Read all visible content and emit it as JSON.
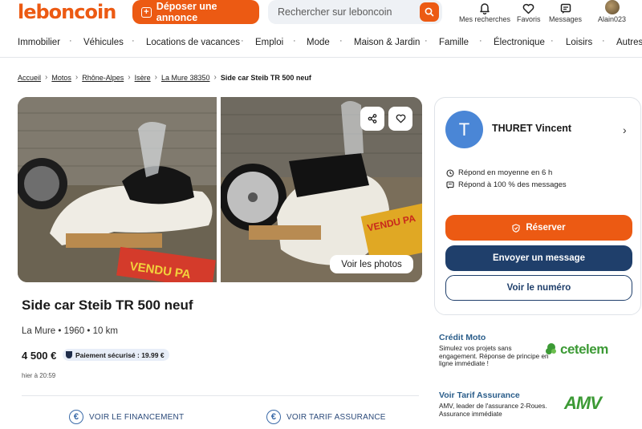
{
  "header": {
    "logo": "leboncoin",
    "deposit_label": "Déposer une annonce",
    "search_placeholder": "Rechercher sur leboncoin",
    "nav": [
      {
        "label": "Mes recherches",
        "icon": "bell-icon"
      },
      {
        "label": "Favoris",
        "icon": "heart-icon"
      },
      {
        "label": "Messages",
        "icon": "message-icon"
      },
      {
        "label": "Alain023",
        "icon": "avatar"
      }
    ]
  },
  "categories": [
    "Immobilier",
    "Véhicules",
    "Locations de vacances",
    "Emploi",
    "Mode",
    "Maison & Jardin",
    "Famille",
    "Électronique",
    "Loisirs",
    "Autres"
  ],
  "breadcrumb": [
    "Accueil",
    "Motos",
    "Rhône-Alpes",
    "Isère",
    "La Mure 38350",
    "Side car Steib TR 500 neuf"
  ],
  "photos": {
    "see_photos_label": "Voir les photos",
    "actions": [
      "share-icon",
      "heart-icon"
    ]
  },
  "ad": {
    "title": "Side car Steib TR 500 neuf",
    "meta": "La Mure • 1960 • 10 km",
    "price": "4 500 €",
    "secure_payment": "Paiement sécurisé : 19.99 €",
    "date": "hier à 20:59",
    "financing_label": "VOIR LE FINANCEMENT",
    "insurance_label": "VOIR TARIF ASSURANCE"
  },
  "seller": {
    "initial": "T",
    "name": "THURET Vincent",
    "response_time": "Répond en moyenne en 6 h",
    "response_rate": "Répond à 100 % des messages",
    "reserve_label": "Réserver",
    "message_label": "Envoyer un message",
    "phone_label": "Voir le numéro"
  },
  "promos": [
    {
      "title": "Crédit Moto",
      "text": "Simulez vos projets sans engagement. Réponse de principe en ligne immédiate !",
      "brand": "cetelem"
    },
    {
      "title": "Voir Tarif Assurance",
      "text": "AMV, leader de l'assurance 2-Roues. Assurance immédiate",
      "brand": "AMV"
    }
  ],
  "colors": {
    "brand": "#ec5a13",
    "navy": "#1f3f6b",
    "link_blue": "#2a5d8a",
    "avatar_blue": "#4a86d6",
    "green": "#3c9a35"
  }
}
